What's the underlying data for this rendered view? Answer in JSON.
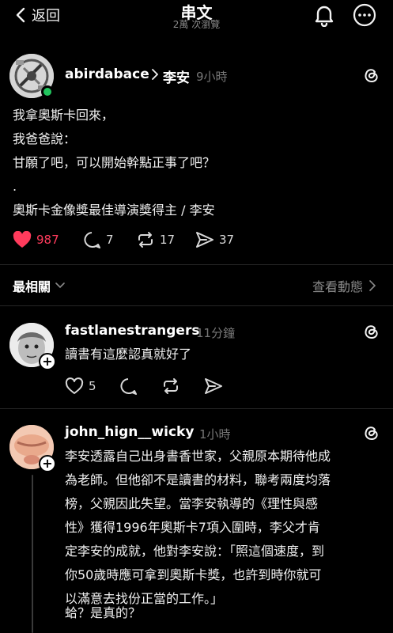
{
  "header": {
    "back_label": "返回",
    "title": "串文",
    "subtitle": "2萬 次瀏覽"
  },
  "post": {
    "username": "abirdabace",
    "reply_to": "李安",
    "time": "9小時",
    "lines": [
      "我拿奧斯卡回來，",
      "我爸爸說：",
      "甘願了吧，可以開始幹點正事了吧？",
      ".",
      "奧斯卡金像獎最佳導演獎得主 / 李安"
    ],
    "likes": "987",
    "comments": "7",
    "reposts": "17",
    "shares": "37"
  },
  "sort": {
    "label": "最相關",
    "view_activity": "查看動態"
  },
  "replies": [
    {
      "username": "fastlanestrangers",
      "time": "11分鐘",
      "text": "讀書有這麼認真就好了",
      "likes": "5"
    },
    {
      "username": "john_hign__wicky",
      "time": "1小時",
      "lines": [
        "李安透露自己出身書香世家，父親原本期待他成",
        "為老師。但他卻不是讀書的材料，聯考兩度均落",
        "榜，父親因此失望。當李安執導的《理性與感",
        "性》獲得1996年奧斯卡7項入圍時，李父才肯",
        "定李安的成就，他對李安說：「照這個速度，到",
        "你50歲時應可拿到奧斯卡獎，也許到時你就可",
        "以滿意去找份正當的工作。」"
      ],
      "followup": "蛤？是真的？"
    }
  ],
  "colors": {
    "background": "#000000",
    "like": "#ff3b5c",
    "online": "#22c55e"
  }
}
